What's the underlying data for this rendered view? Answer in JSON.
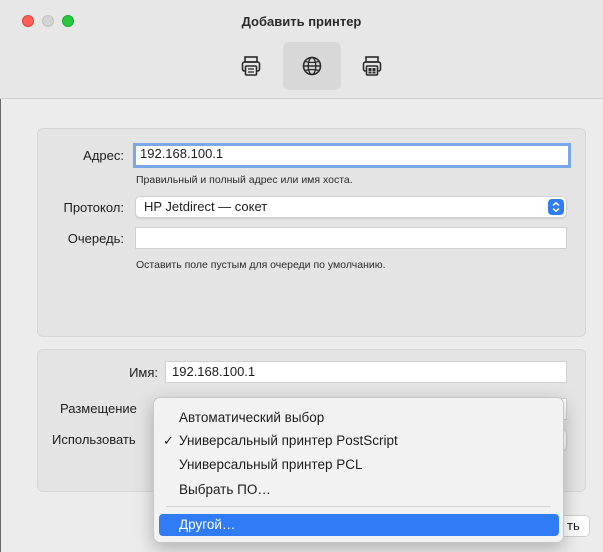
{
  "window": {
    "title": "Добавить принтер"
  },
  "toolbar": {
    "items": [
      {
        "name": "default-printer",
        "icon": "printer-icon",
        "selected": false
      },
      {
        "name": "ip-printer",
        "icon": "globe-icon",
        "selected": true
      },
      {
        "name": "windows-printer",
        "icon": "printer-icon",
        "selected": false
      }
    ]
  },
  "address": {
    "label": "Адрес:",
    "value": "192.168.100.1",
    "hint": "Правильный и полный адрес или имя хоста."
  },
  "protocol": {
    "label": "Протокол:",
    "value": "HP Jetdirect — сокет"
  },
  "queue": {
    "label": "Очередь:",
    "value": "",
    "hint": "Оставить поле пустым для очереди по умолчанию."
  },
  "name_field": {
    "label": "Имя:",
    "value": "192.168.100.1"
  },
  "location": {
    "label": "Размещение"
  },
  "use": {
    "label": "Использовать"
  },
  "driver_menu": {
    "items": [
      {
        "label": "Автоматический выбор",
        "checked": false,
        "highlight": false
      },
      {
        "label": "Универсальный принтер PostScript",
        "checked": true,
        "highlight": false
      },
      {
        "label": "Универсальный принтер PCL",
        "checked": false,
        "highlight": false
      },
      {
        "label": "Выбрать ПО…",
        "checked": false,
        "highlight": false
      },
      {
        "label": "Другой…",
        "checked": false,
        "highlight": true
      }
    ],
    "check_mark": "✓"
  },
  "add_button": {
    "label_visible_fragment": "ть"
  },
  "colors": {
    "accent": "#2f7cf6",
    "close": "#fe5f57",
    "max": "#28c840"
  }
}
